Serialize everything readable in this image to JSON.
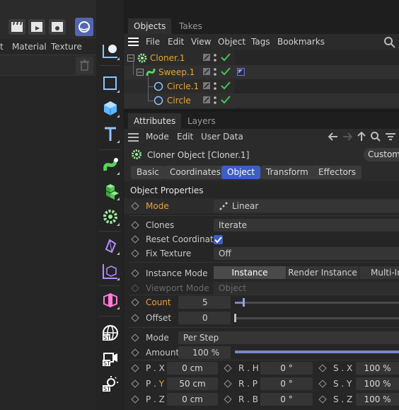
{
  "left_panel": {
    "menu": [
      "t",
      "Material",
      "Texture"
    ]
  },
  "objects_panel": {
    "tabs": [
      "Objects",
      "Takes"
    ],
    "menu": [
      "File",
      "Edit",
      "View",
      "Object",
      "Tags",
      "Bookmarks"
    ],
    "rows": [
      {
        "name": "Cloner.1"
      },
      {
        "name": "Sweep.1"
      },
      {
        "name": "Circle.1"
      },
      {
        "name": "Circle"
      }
    ]
  },
  "attributes_panel": {
    "tabs": [
      "Attributes",
      "Layers"
    ],
    "menu": [
      "Mode",
      "Edit",
      "User Data"
    ],
    "header_title": "Cloner Object [Cloner.1]",
    "header_button": "Custom",
    "subtabs": [
      "Basic",
      "Coordinates",
      "Object",
      "Transform",
      "Effectors"
    ],
    "active_subtab": "Object",
    "section_title": "Object Properties",
    "props": {
      "mode_label": "Mode",
      "mode_value": "Linear",
      "clones_label": "Clones",
      "clones_value": "Iterate",
      "reset_label": "Reset Coordinates",
      "reset_checked": true,
      "fix_texture_label": "Fix Texture",
      "fix_texture_value": "Off",
      "instance_mode_label": "Instance Mode",
      "instance_modes": [
        "Instance",
        "Render Instance",
        "Multi-In"
      ],
      "viewport_mode_label": "Viewport Mode",
      "viewport_mode_value": "Object",
      "count_label": "Count",
      "count_value": "5",
      "offset_label": "Offset",
      "offset_value": "0",
      "mode2_label": "Mode",
      "mode2_value": "Per Step",
      "amount_label": "Amount",
      "amount_value": "100 %"
    },
    "transform": {
      "p_x_label": "P . X",
      "p_x": "0 cm",
      "r_h_label": "R . H",
      "r_h": "0 °",
      "s_x_label": "S . X",
      "s_x": "100 %",
      "p_y_label_a": "P . ",
      "p_y_label_b": "Y",
      "p_y": "50 cm",
      "r_p_label": "R . P",
      "r_p": "0 °",
      "s_y_label": "S . Y",
      "s_y": "100 %",
      "p_z_label": "P . Z",
      "p_z": "0 cm",
      "r_b_label": "R . B",
      "r_b": "0 °",
      "s_z_label": "S . Z",
      "s_z": "100 %"
    }
  },
  "colors": {
    "accent_blue": "#3d5ec6",
    "highlight_orange": "#e8a33c",
    "check_green": "#3ecb4a"
  }
}
